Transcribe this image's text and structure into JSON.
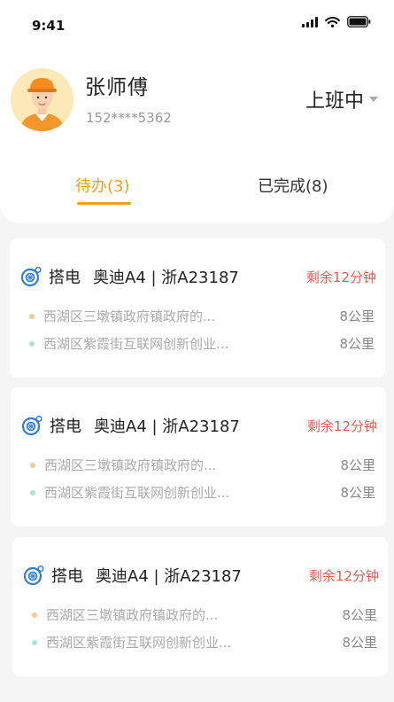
{
  "status_bar": {
    "time": "9:41"
  },
  "profile": {
    "name": "张师傅",
    "phone": "152****5362",
    "duty_status": "上班中"
  },
  "tabs": [
    {
      "label": "待办(3)",
      "active": true
    },
    {
      "label": "已完成(8)",
      "active": false
    }
  ],
  "colors": {
    "accent": "#f3a019",
    "countdown": "#e85a4f",
    "origin_dot": "#f7c98a",
    "destination_dot": "#a8e6d8",
    "icon_blue": "#2d7ee0"
  },
  "tasks": [
    {
      "service": "搭电",
      "vehicle": "奥迪A4 | 浙A23187",
      "remaining": "剩余12分钟",
      "origin": {
        "address": "西湖区三墩镇政府镇政府的...",
        "distance": "8公里"
      },
      "destination": {
        "address": "西湖区紫霞街互联网创新创业...",
        "distance": "8公里"
      }
    },
    {
      "service": "搭电",
      "vehicle": "奥迪A4 | 浙A23187",
      "remaining": "剩余12分钟",
      "origin": {
        "address": "西湖区三墩镇政府镇政府的...",
        "distance": "8公里"
      },
      "destination": {
        "address": "西湖区紫霞街互联网创新创业...",
        "distance": "8公里"
      }
    },
    {
      "service": "搭电",
      "vehicle": "奥迪A4 | 浙A23187",
      "remaining": "剩余12分钟",
      "origin": {
        "address": "西湖区三墩镇政府镇政府的...",
        "distance": "8公里"
      },
      "destination": {
        "address": "西湖区紫霞街互联网创新创业...",
        "distance": "8公里"
      }
    }
  ]
}
